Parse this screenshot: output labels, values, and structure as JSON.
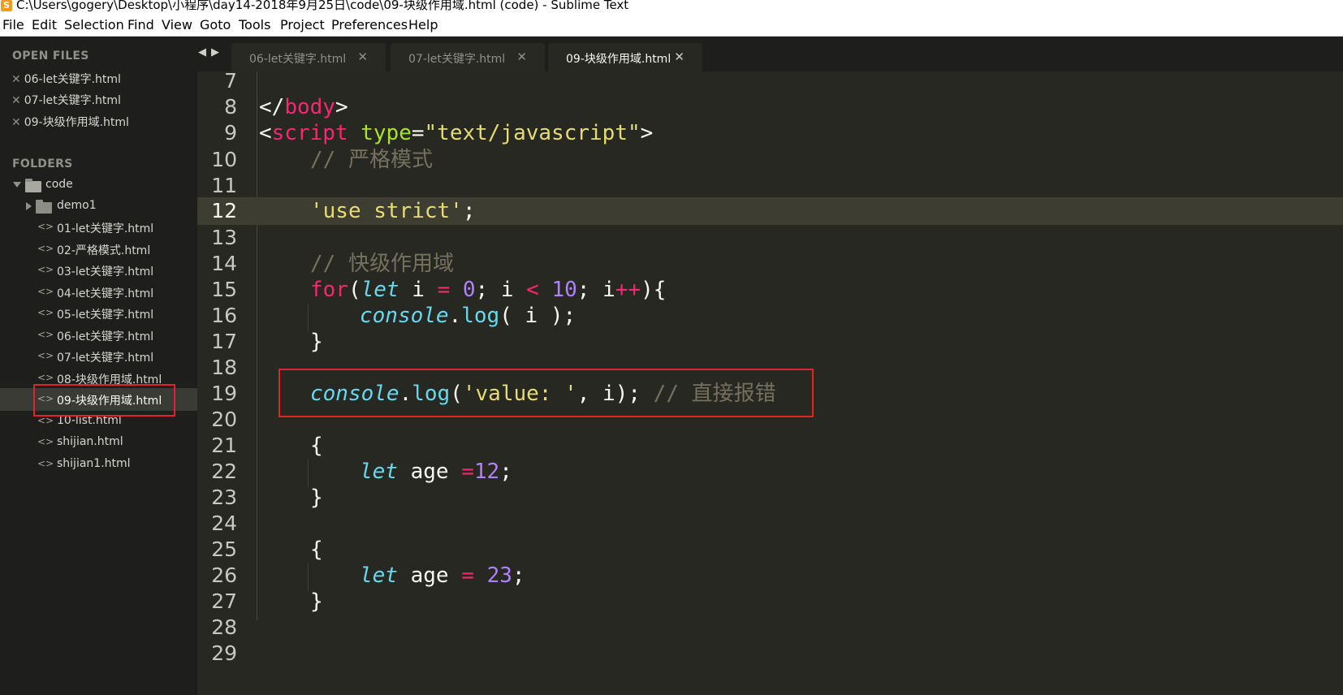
{
  "window": {
    "title": "C:\\Users\\gogery\\Desktop\\小程序\\day14-2018年9月25日\\code\\09-块级作用域.html (code) - Sublime Text"
  },
  "menu": [
    "File",
    "Edit",
    "Selection",
    "Find",
    "View",
    "Goto",
    "Tools",
    "Project",
    "Preferences",
    "Help"
  ],
  "sidebar": {
    "open_files_heading": "OPEN FILES",
    "open_files": [
      "06-let关键字.html",
      "07-let关键字.html",
      "09-块级作用域.html"
    ],
    "folders_heading": "FOLDERS",
    "root_folder": "code",
    "subfolder": "demo1",
    "files": [
      "01-let关键字.html",
      "02-严格模式.html",
      "03-let关键字.html",
      "04-let关键字.html",
      "05-let关键字.html",
      "06-let关键字.html",
      "07-let关键字.html",
      "08-块级作用域.html",
      "09-块级作用域.html",
      "10-list.html",
      "shijian.html",
      "shijian1.html"
    ],
    "selected_file": "09-块级作用域.html"
  },
  "tabs": [
    {
      "label": "06-let关键字.html",
      "active": false
    },
    {
      "label": "07-let关键字.html",
      "active": false
    },
    {
      "label": "09-块级作用域.html",
      "active": true
    }
  ],
  "editor": {
    "current_line": 12,
    "highlighted_line": 19,
    "lines": [
      {
        "n": "7"
      },
      {
        "n": "8"
      },
      {
        "n": "9"
      },
      {
        "n": "10"
      },
      {
        "n": "11"
      },
      {
        "n": "12"
      },
      {
        "n": "13"
      },
      {
        "n": "14"
      },
      {
        "n": "15"
      },
      {
        "n": "16"
      },
      {
        "n": "17"
      },
      {
        "n": "18"
      },
      {
        "n": "19"
      },
      {
        "n": "20"
      },
      {
        "n": "21"
      },
      {
        "n": "22"
      },
      {
        "n": "23"
      },
      {
        "n": "24"
      },
      {
        "n": "25"
      },
      {
        "n": "26"
      },
      {
        "n": "27"
      },
      {
        "n": "28"
      },
      {
        "n": "29"
      }
    ],
    "code": {
      "l8": [
        "</",
        "body",
        ">"
      ],
      "l9": [
        "<",
        "script",
        " ",
        "type",
        "=",
        "\"text/javascript\"",
        ">"
      ],
      "l10": "// 严格模式",
      "l12": [
        "'use strict'",
        ";"
      ],
      "l14": "// 快级作用域",
      "l15": [
        "for",
        "(",
        "let",
        " i ",
        "=",
        " ",
        "0",
        "; i ",
        "<",
        " ",
        "10",
        "; i",
        "++",
        "){"
      ],
      "l16": [
        "console",
        ".",
        "log",
        "( i );"
      ],
      "l17": "}",
      "l19": [
        "console",
        ".",
        "log",
        "(",
        "'value: '",
        ", i); ",
        "// 直接报错"
      ],
      "l21": "{",
      "l22": [
        "let",
        " age ",
        "=",
        "12",
        ";"
      ],
      "l23": "}",
      "l25": "{",
      "l26": [
        "let",
        " age ",
        "=",
        " ",
        "23",
        ";"
      ],
      "l27": "}"
    }
  },
  "colors": {
    "background": "#272822",
    "sidebar": "#1e1f1c",
    "tag": "#f92672",
    "attribute": "#a6e22e",
    "string": "#e6db74",
    "comment": "#75715e",
    "keyword_italic": "#66d9ef",
    "number": "#ae81ff",
    "annotation_box": "#e0242a"
  }
}
